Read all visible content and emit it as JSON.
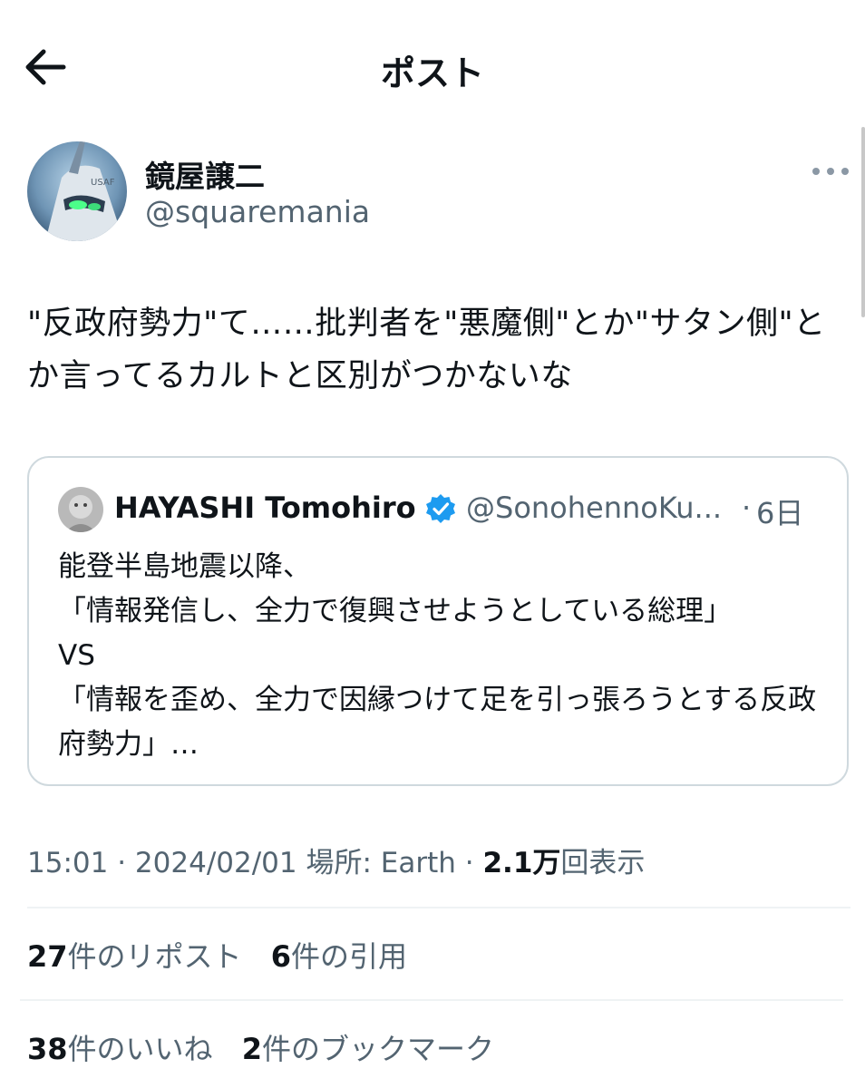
{
  "header": {
    "title": "ポスト"
  },
  "author": {
    "display_name": "鏡屋譲二",
    "handle": "@squaremania"
  },
  "post": {
    "text": "\"反政府勢力\"て……批判者を\"悪魔側\"とか\"サタン側\"とか言ってるカルトと区別がつかないな"
  },
  "quote": {
    "name": "HAYASHI Tomohiro",
    "handle": "@SonohennoKu...",
    "separator": "·",
    "time": "6日",
    "text": "能登半島地震以降、\n「情報発信し、全力で復興させようとしている総理」\nVS\n「情報を歪め、全力で因縁つけて足を引っ張ろうとする反政府勢力」…"
  },
  "meta": {
    "time": "15:01",
    "date": "2024/02/01",
    "location_label": "場所: Earth",
    "separator": "·",
    "views_count": "2.1万",
    "views_label": "回表示"
  },
  "stats": {
    "reposts": {
      "count": "27",
      "label": "件のリポスト"
    },
    "quotes": {
      "count": "6",
      "label": "件の引用"
    },
    "likes": {
      "count": "38",
      "label": "件のいいね"
    },
    "bookmarks": {
      "count": "2",
      "label": "件のブックマーク"
    }
  },
  "colors": {
    "text": "#0f1419",
    "secondary": "#536471",
    "border": "#cfd9de",
    "verified": "#1d9bf0"
  },
  "icons": {
    "back": "arrow-left-icon",
    "more": "more-horizontal-icon",
    "verified": "verified-badge-icon"
  }
}
